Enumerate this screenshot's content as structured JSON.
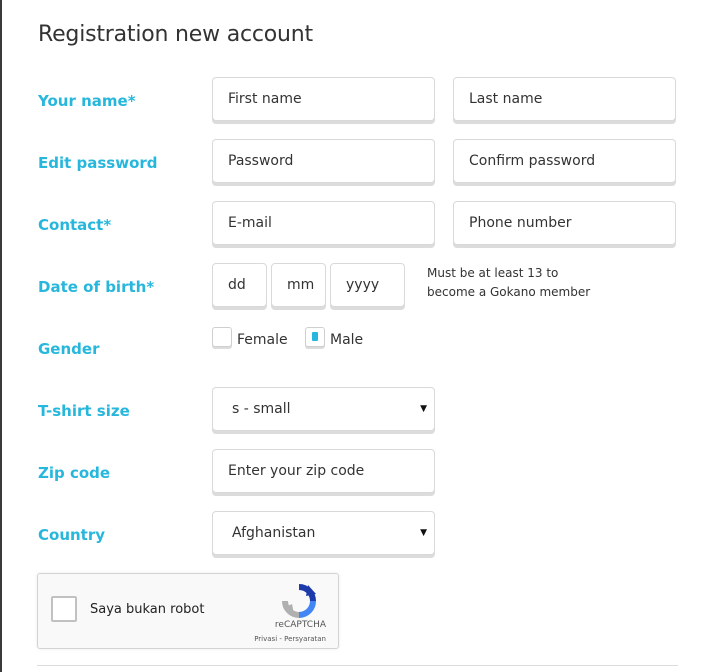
{
  "form": {
    "title": "Registration new account",
    "labels": {
      "name": "Your name*",
      "password": "Edit password",
      "contact": "Contact*",
      "dob": "Date of birth*",
      "gender": "Gender",
      "tshirt": "T-shirt size",
      "zip": "Zip code",
      "country": "Country"
    },
    "placeholders": {
      "first_name": "First name",
      "last_name": "Last name",
      "password": "Password",
      "confirm_password": "Confirm password",
      "email": "E-mail",
      "phone": "Phone number",
      "dd": "dd",
      "mm": "mm",
      "yyyy": "yyyy",
      "zip": "Enter your zip code"
    },
    "dob_note_line1": "Must be at least 13 to",
    "dob_note_line2": "become a Gokano member",
    "gender_options": {
      "female": "Female",
      "male": "Male"
    },
    "gender_selected": "Male",
    "tshirt_value": "s - small",
    "country_value": "Afghanistan",
    "caret": "▼"
  },
  "captcha": {
    "label": "Saya bukan robot",
    "brand": "reCAPTCHA",
    "links": "Privasi - Persyaratan"
  },
  "colors": {
    "accent": "#27b7dc",
    "text": "#333333",
    "border": "#d9d9d9"
  }
}
